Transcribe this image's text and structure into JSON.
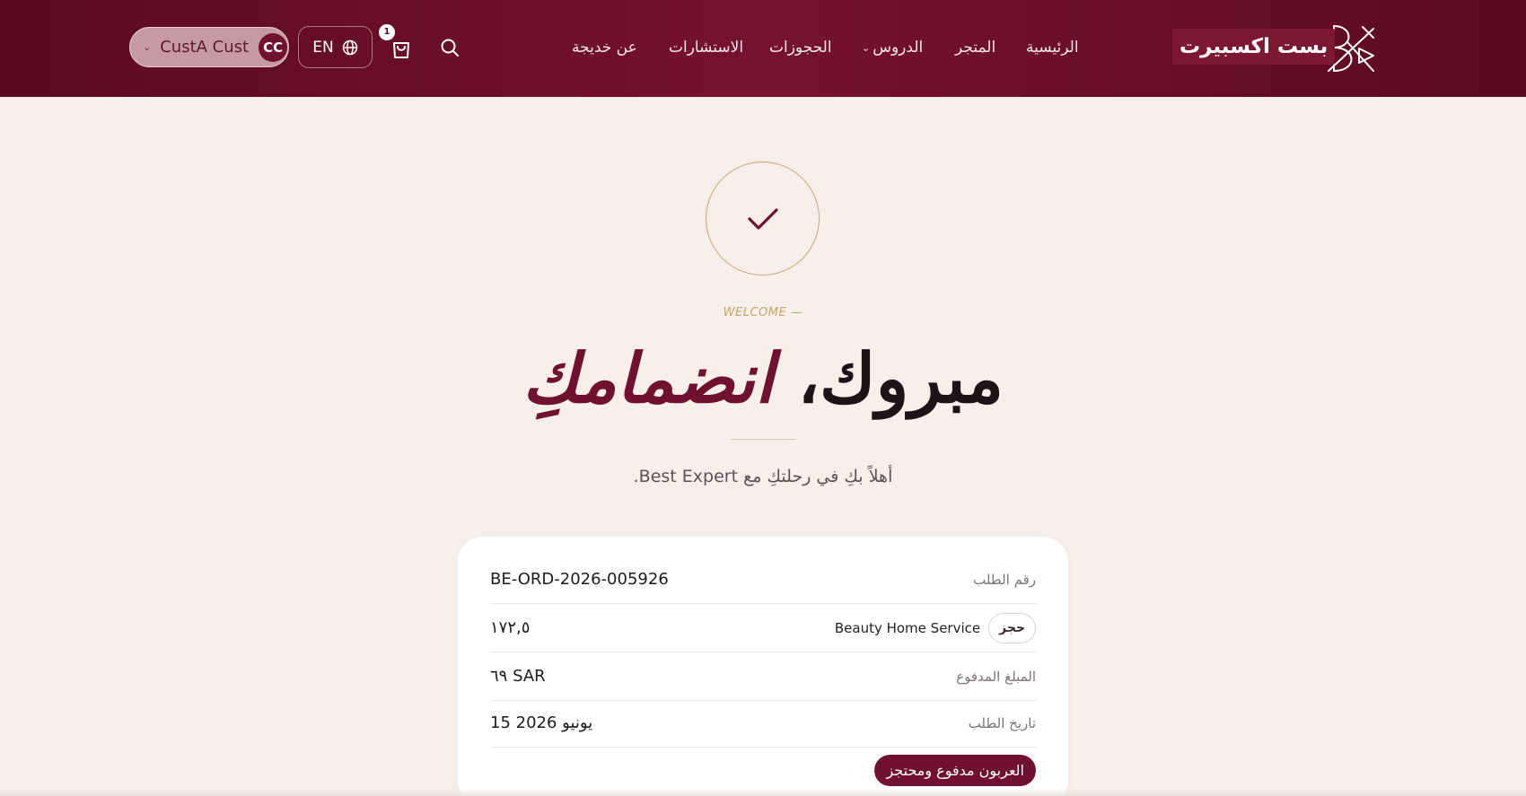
{
  "header": {
    "brand_name": "بست اكسبيرت",
    "nav": {
      "home": "الرئيسية",
      "store": "المتجر",
      "lessons": "الدروس",
      "bookings": "الحجوزات",
      "consultations": "الاستشارات",
      "about": "عن خديجة"
    },
    "cart_count": "1",
    "language": "EN",
    "user": {
      "name": "CustA Cust",
      "initials": "CC"
    }
  },
  "hero": {
    "eyebrow": "WELCOME —",
    "headline_plain": "مبروك،",
    "headline_accent": "انضمامكِ",
    "subtitle": "أهلاً بكِ في رحلتكِ مع Best Expert."
  },
  "order": {
    "number_label": "رقم الطلب",
    "number_value": "BE-ORD-2026-005926",
    "item_type": "حجز",
    "item_name": "Beauty Home Service",
    "item_price": "١٧٢,٥",
    "paid_label": "المبلغ المدفوع",
    "paid_value": "٦٩ SAR",
    "date_label": "تاريخ الطلب",
    "date_value": "15 يونيو 2026",
    "status": "العربون مدفوع ومحتجز"
  },
  "colors": {
    "brand": "#701130",
    "header_dark": "#5a0a20",
    "background": "#f6efea",
    "gold": "#c9a47a"
  },
  "icons": [
    "brand-logo-icon",
    "chevron-down-icon",
    "search-icon",
    "cart-icon",
    "globe-icon",
    "check-icon"
  ]
}
